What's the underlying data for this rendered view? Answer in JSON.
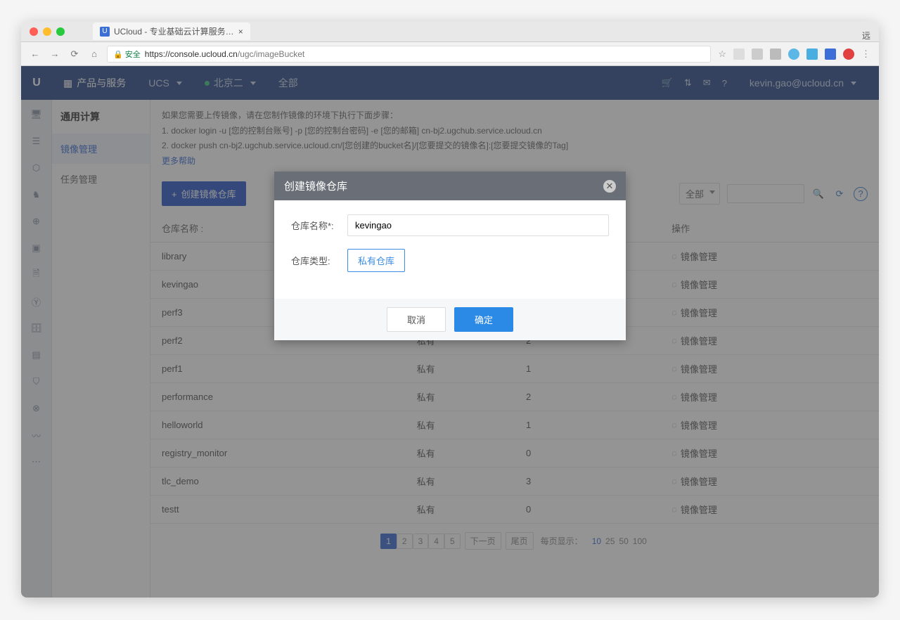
{
  "browser": {
    "tab_title": "UCloud - 专业基础云计算服务…",
    "secure_label": "安全",
    "url_host": "https://console.ucloud.cn",
    "url_path": "/ugc/imageBucket",
    "remote_label": "远"
  },
  "topbar": {
    "products": "产品与服务",
    "service": "UCS",
    "region": "北京二",
    "scope": "全部",
    "user": "kevin.gao@ucloud.cn"
  },
  "sidebar": {
    "title": "通用计算",
    "items": [
      "镜像管理",
      "任务管理"
    ]
  },
  "instructions": {
    "line0": "如果您需要上传镜像，请在您制作镜像的环境下执行下面步骤：",
    "line1": "1. docker login -u [您的控制台账号] -p [您的控制台密码] -e [您的邮箱] cn-bj2.ugchub.service.ucloud.cn",
    "line2": "2. docker push cn-bj2.ugchub.service.ucloud.cn/[您创建的bucket名]/[您要提交的镜像名]:[您要提交镜像的Tag]",
    "more": "更多帮助"
  },
  "toolbar": {
    "create": "创建镜像仓库",
    "filter": "全部"
  },
  "table": {
    "headers": [
      "仓库名称 :",
      "",
      "",
      "操作"
    ],
    "rows": [
      {
        "name": "library",
        "type": "",
        "count": "",
        "op": "镜像管理"
      },
      {
        "name": "kevingao",
        "type": "",
        "count": "",
        "op": "镜像管理"
      },
      {
        "name": "perf3",
        "type": "",
        "count": "",
        "op": "镜像管理"
      },
      {
        "name": "perf2",
        "type": "私有",
        "count": "2",
        "op": "镜像管理"
      },
      {
        "name": "perf1",
        "type": "私有",
        "count": "1",
        "op": "镜像管理"
      },
      {
        "name": "performance",
        "type": "私有",
        "count": "2",
        "op": "镜像管理"
      },
      {
        "name": "helloworld",
        "type": "私有",
        "count": "1",
        "op": "镜像管理"
      },
      {
        "name": "registry_monitor",
        "type": "私有",
        "count": "0",
        "op": "镜像管理"
      },
      {
        "name": "tlc_demo",
        "type": "私有",
        "count": "3",
        "op": "镜像管理"
      },
      {
        "name": "testt",
        "type": "私有",
        "count": "0",
        "op": "镜像管理"
      }
    ]
  },
  "pagination": {
    "pages": [
      "1",
      "2",
      "3",
      "4",
      "5"
    ],
    "next": "下一页",
    "last": "尾页",
    "per_page_label": "每页显示：",
    "sizes": [
      "10",
      "25",
      "50",
      "100"
    ]
  },
  "modal": {
    "title": "创建镜像仓库",
    "name_label": "仓库名称*:",
    "name_value": "kevingao",
    "type_label": "仓库类型:",
    "type_value": "私有仓库",
    "cancel": "取消",
    "confirm": "确定"
  }
}
